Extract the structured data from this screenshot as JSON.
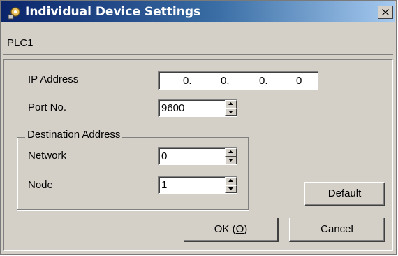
{
  "window": {
    "title": "Individual Device Settings",
    "title_colors": {
      "start": "#0a246a",
      "end": "#a6caf0"
    }
  },
  "device": {
    "name": "PLC1"
  },
  "form": {
    "ip_label": "IP Address",
    "ip_octets": [
      "0.",
      "0.",
      "0.",
      "0"
    ],
    "port_label": "Port No.",
    "port_value": "9600",
    "group_title": "Destination Address",
    "network_label": "Network",
    "network_value": "0",
    "node_label": "Node",
    "node_value": "1"
  },
  "buttons": {
    "default": "Default",
    "ok_prefix": "OK (",
    "ok_mnemonic": "O",
    "ok_suffix": ")",
    "cancel": "Cancel"
  },
  "icons": {
    "app": "settings-gear-icon",
    "close": "close-icon",
    "spin_up": "arrow-up-icon",
    "spin_down": "arrow-down-icon"
  }
}
